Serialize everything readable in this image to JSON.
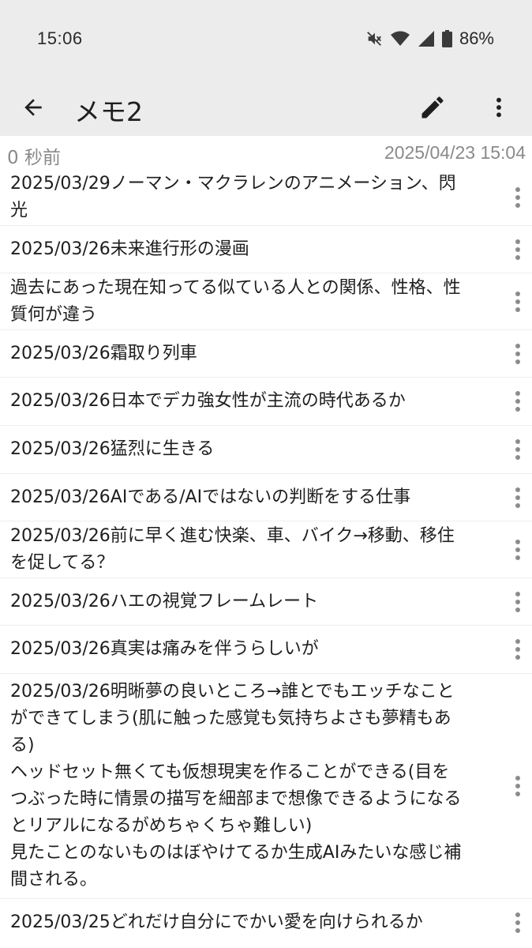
{
  "status": {
    "time": "15:06",
    "battery": "86%"
  },
  "header": {
    "title": "メモ2",
    "back_icon": "arrow-left-icon",
    "edit_icon": "pencil-icon",
    "menu_icon": "more-vertical-icon"
  },
  "info": {
    "relative_time": "0 秒前",
    "timestamp": "2025/04/23 15:04"
  },
  "memos": [
    {
      "text": "2025/03/29ノーマン・マクラレンのアニメーション、閃光"
    },
    {
      "text": "2025/03/26未来進行形の漫画"
    },
    {
      "text": "過去にあった現在知ってる似ている人との関係、性格、性質何が違う"
    },
    {
      "text": "2025/03/26霜取り列車"
    },
    {
      "text": "2025/03/26日本でデカ強女性が主流の時代あるか"
    },
    {
      "text": "2025/03/26猛烈に生きる"
    },
    {
      "text": "2025/03/26AIである/AIではないの判断をする仕事"
    },
    {
      "text": "2025/03/26前に早く進む快楽、車、バイク→移動、移住を促してる？"
    },
    {
      "text": "2025/03/26ハエの視覚フレームレート"
    },
    {
      "text": "2025/03/26真実は痛みを伴うらしいが"
    },
    {
      "text": "2025/03/26明晰夢の良いところ→誰とでもエッチなことができてしまう(肌に触った感覚も気持ちよさも夢精もある)\nヘッドセット無くても仮想現実を作ることができる(目をつぶった時に情景の描写を細部まで想像できるようになるとリアルになるがめちゃくちゃ難しい)\n見たことのないものはぼやけてるか生成AIみたいな感じ補間される。"
    },
    {
      "text": "2025/03/25どれだけ自分にでかい愛を向けられるか"
    }
  ]
}
